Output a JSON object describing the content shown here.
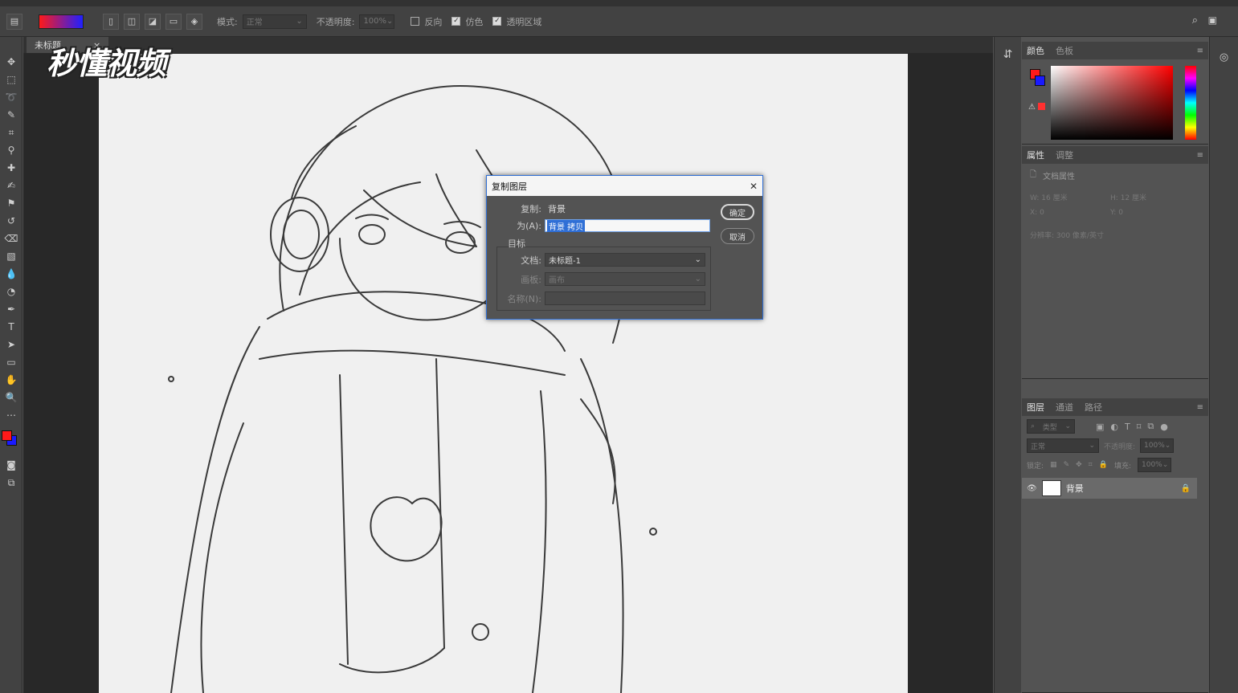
{
  "watermark": "秒懂视频",
  "options_bar": {
    "mode_label": "模式:",
    "mode_value": "正常",
    "opacity_label": "不透明度:",
    "opacity_value": "100%",
    "reverse_label": "反向",
    "dither_label": "仿色",
    "transparency_label": "透明区域"
  },
  "document_tab": {
    "title": "未标题",
    "close": "×"
  },
  "color_panel": {
    "tabs": [
      "颜色",
      "色板"
    ],
    "foreground": "#ff1a1a",
    "background": "#1a1aff"
  },
  "properties_panel": {
    "tabs": [
      "属性",
      "调整"
    ],
    "section": "文档属性",
    "w_label": "W:",
    "w_value": "16 厘米",
    "h_label": "H:",
    "h_value": "12 厘米",
    "x_label": "X:",
    "x_value": "0",
    "y_label": "Y:",
    "y_value": "0",
    "resolution": "分辨率: 300 像素/英寸"
  },
  "layers_panel": {
    "tabs": [
      "图层",
      "通道",
      "路径"
    ],
    "filter_label": "类型",
    "blend_mode": "正常",
    "opacity_label": "不透明度:",
    "opacity_value": "100%",
    "lock_label": "锁定:",
    "fill_label": "填充:",
    "fill_value": "100%",
    "layers": [
      {
        "name": "背景"
      }
    ]
  },
  "dialog": {
    "title": "复制图层",
    "close": "✕",
    "duplicate_label": "复制:",
    "duplicate_value": "背景",
    "as_label": "为(A):",
    "as_value": "背景 拷贝",
    "target_label": "目标",
    "document_label": "文档:",
    "document_value": "未标题-1",
    "artboard_label": "画板:",
    "artboard_value": "画布",
    "name_label": "名称(N):",
    "name_value": "",
    "ok_label": "确定",
    "cancel_label": "取消"
  }
}
